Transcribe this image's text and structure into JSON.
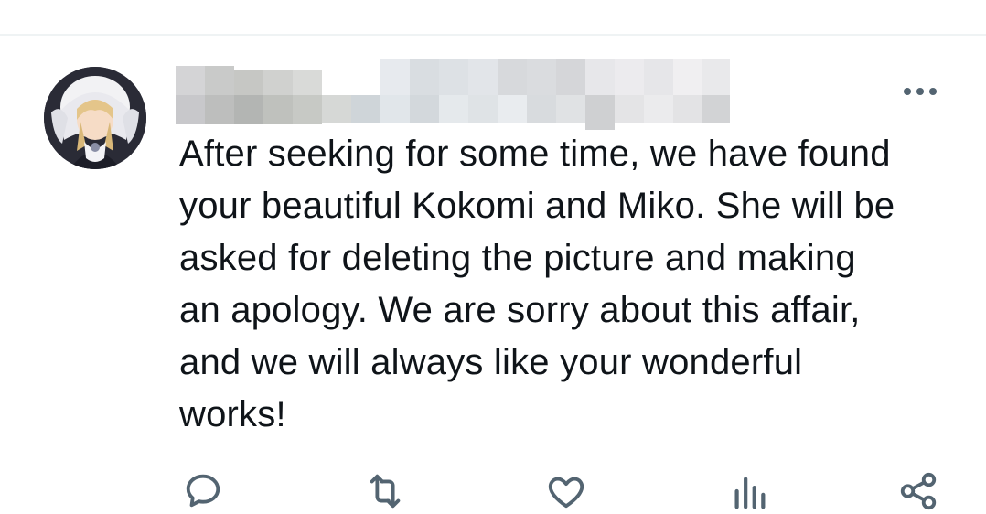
{
  "tweet": {
    "author_name": "",
    "avatar_icon": "anime-character-avatar",
    "more_icon": "more-horizontal-icon",
    "text_lines": [
      "After seeking for some time, we have found",
      "your beautiful Kokomi and Miko. She will be",
      "asked for deleting the picture and making",
      "an apology. We are sorry about this affair,",
      "and we will always like your wonderful",
      "works!"
    ]
  },
  "actions": [
    {
      "icon": "reply-icon"
    },
    {
      "icon": "retweet-icon"
    },
    {
      "icon": "like-icon"
    },
    {
      "icon": "analytics-icon"
    },
    {
      "icon": "share-icon"
    }
  ],
  "colors": {
    "text": "#0f1419",
    "icon": "#536471",
    "divider": "#eff3f4"
  }
}
